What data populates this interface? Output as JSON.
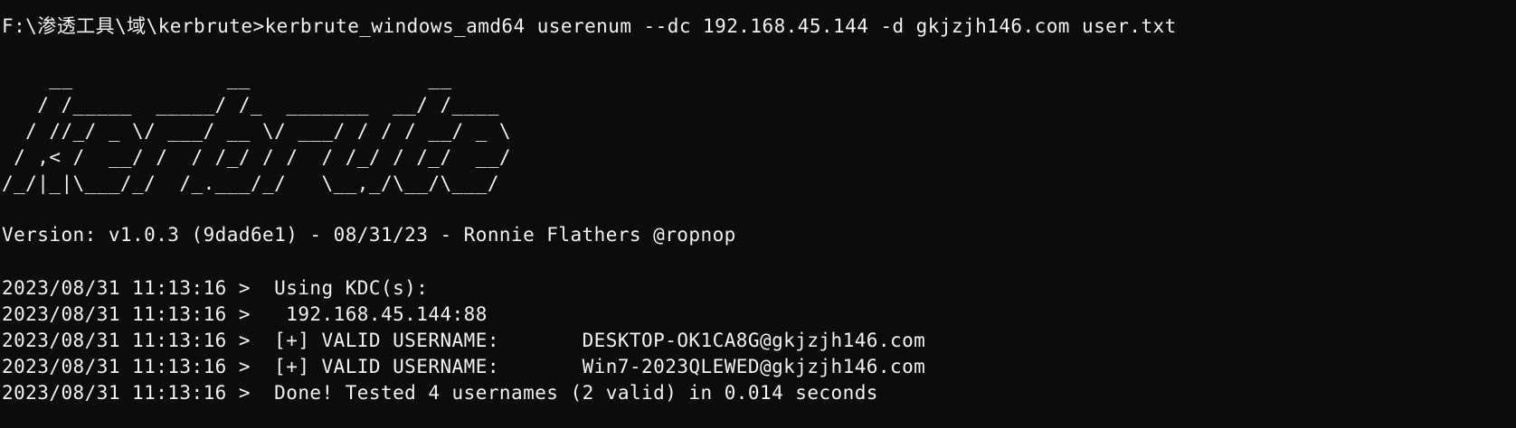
{
  "terminal": {
    "prompt": "F:\\渗透工具\\域\\kerbrute>",
    "command": "kerbrute_windows_amd64 userenum --dc 192.168.45.144 -d gkjzjh146.com user.txt",
    "banner": "    __             __               __     \n   / /_____  _____/ /_  _______  __/ /____ \n  / //_/ _ \\/ ___/ __ \\/ ___/ / / / __/ _ \\\n / ,< /  __/ /  / /_/ / /  / /_/ / /_/  __/\n/_/|_|\\___/_/  /_.___/_/   \\__,_/\\__/\\___/ ",
    "version": "Version: v1.0.3 (9dad6e1) - 08/31/23 - Ronnie Flathers @ropnop",
    "log": [
      {
        "timestamp": "2023/08/31 11:13:16 >",
        "message": "  Using KDC(s):"
      },
      {
        "timestamp": "2023/08/31 11:13:16 >",
        "message": "   192.168.45.144:88"
      },
      {
        "timestamp": "2023/08/31 11:13:16 >",
        "message": "  [+] VALID USERNAME:       DESKTOP-OK1CA8G@gkjzjh146.com"
      },
      {
        "timestamp": "2023/08/31 11:13:16 >",
        "message": "  [+] VALID USERNAME:       Win7-2023QLEWED@gkjzjh146.com"
      },
      {
        "timestamp": "2023/08/31 11:13:16 >",
        "message": "  Done! Tested 4 usernames (2 valid) in 0.014 seconds"
      }
    ]
  },
  "colors": {
    "background": "#0c0c0c",
    "foreground": "#f2f2f2"
  }
}
